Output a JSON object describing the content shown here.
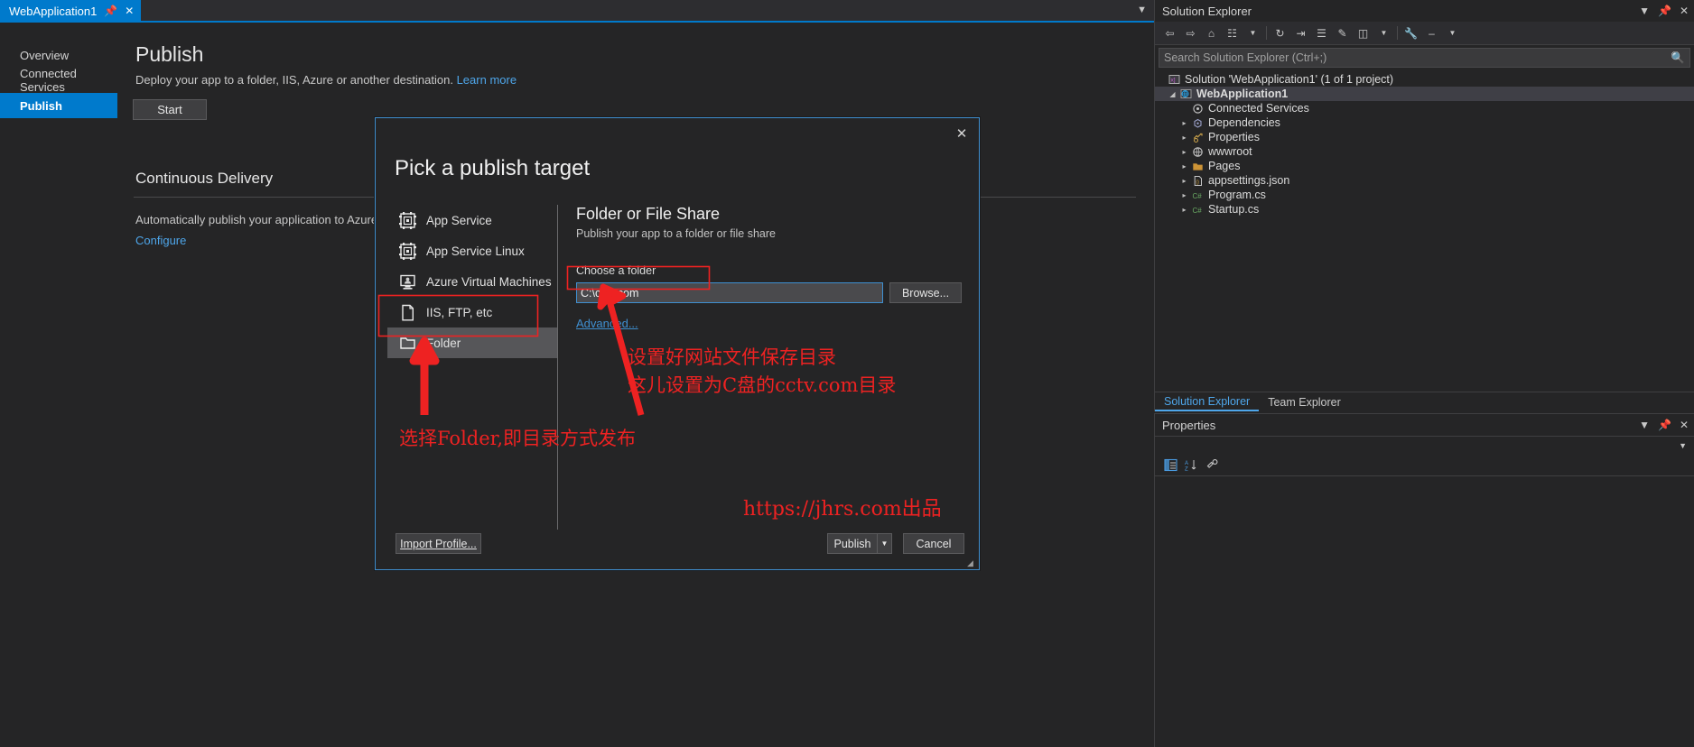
{
  "tabstrip": {
    "tab_label": "WebApplication1",
    "pin_icon": "pin-icon",
    "close_icon": "close-icon",
    "overflow_icon": "chevron-down-icon"
  },
  "doc_nav": {
    "items": [
      {
        "label": "Overview",
        "selected": false
      },
      {
        "label": "Connected Services",
        "selected": false
      },
      {
        "label": "Publish",
        "selected": true
      }
    ]
  },
  "publish_page": {
    "title": "Publish",
    "description": "Deploy your app to a folder, IIS, Azure or another destination.",
    "learn_more": "Learn more",
    "start_button": "Start",
    "cd_title": "Continuous Delivery",
    "cd_description": "Automatically publish your application to Azure with co",
    "configure_link": "Configure"
  },
  "dialog": {
    "heading": "Pick a publish target",
    "close_icon": "close-icon",
    "targets": [
      {
        "label": "App Service",
        "icon": "app-service-icon",
        "selected": false
      },
      {
        "label": "App Service Linux",
        "icon": "app-service-linux-icon",
        "selected": false
      },
      {
        "label": "Azure Virtual Machines",
        "icon": "azure-vm-icon",
        "selected": false
      },
      {
        "label": "IIS, FTP, etc",
        "icon": "iis-ftp-icon",
        "selected": false
      },
      {
        "label": "Folder",
        "icon": "folder-icon",
        "selected": true
      }
    ],
    "detail": {
      "title": "Folder or File Share",
      "subtitle": "Publish your app to a folder or file share",
      "choose_label": "Choose a folder",
      "folder_value": "C:\\cctv.com",
      "folder_placeholder": "",
      "browse_button": "Browse...",
      "advanced_link": "Advanced..."
    },
    "footer": {
      "import_profile": "Import Profile...",
      "publish_button": "Publish",
      "publish_dropdown_icon": "chevron-down-icon",
      "cancel_button": "Cancel",
      "resize_grip_icon": "resize-grip-icon"
    }
  },
  "annotations": {
    "color": "#ee2222",
    "folder_note": "选择Folder,即目录方式发布",
    "path_note_line1": "设置好网站文件保存目录",
    "path_note_line2": "这儿设置为C盘的cctv.com目录",
    "watermark": "https://jhrs.com出品"
  },
  "solution_explorer": {
    "title": "Solution Explorer",
    "header_icons": [
      "chevron-down-icon",
      "pin-icon",
      "close-icon"
    ],
    "toolbar_icons": [
      "back-icon",
      "forward-icon",
      "home-icon",
      "switch-views-icon",
      "chevron-down-icon",
      "refresh-icon",
      "collapse-all-icon",
      "show-all-files-icon",
      "properties-icon",
      "preview-icon",
      "chevron-down-icon",
      "wrench-icon",
      "minus-icon",
      "chevron-down-icon"
    ],
    "search_placeholder": "Search Solution Explorer (Ctrl+;)",
    "search_icon": "search-icon",
    "tree": [
      {
        "label": "Solution 'WebApplication1' (1 of 1 project)",
        "icon": "solution-icon",
        "depth": 0,
        "twisty": "",
        "bold": false,
        "highlight": false
      },
      {
        "label": "WebApplication1",
        "icon": "web-project-icon",
        "depth": 1,
        "twisty": "expanded",
        "bold": true,
        "highlight": true
      },
      {
        "label": "Connected Services",
        "icon": "connected-services-icon",
        "depth": 2,
        "twisty": "",
        "bold": false,
        "highlight": false
      },
      {
        "label": "Dependencies",
        "icon": "dependencies-icon",
        "depth": 2,
        "twisty": "collapsed",
        "bold": false,
        "highlight": false
      },
      {
        "label": "Properties",
        "icon": "properties-folder-icon",
        "depth": 2,
        "twisty": "collapsed",
        "bold": false,
        "highlight": false
      },
      {
        "label": "wwwroot",
        "icon": "wwwroot-icon",
        "depth": 2,
        "twisty": "collapsed",
        "bold": false,
        "highlight": false
      },
      {
        "label": "Pages",
        "icon": "folder-icon",
        "depth": 2,
        "twisty": "collapsed",
        "bold": false,
        "highlight": false
      },
      {
        "label": "appsettings.json",
        "icon": "json-icon",
        "depth": 2,
        "twisty": "collapsed",
        "bold": false,
        "highlight": false
      },
      {
        "label": "Program.cs",
        "icon": "csharp-icon",
        "depth": 2,
        "twisty": "collapsed",
        "bold": false,
        "highlight": false
      },
      {
        "label": "Startup.cs",
        "icon": "csharp-icon",
        "depth": 2,
        "twisty": "collapsed",
        "bold": false,
        "highlight": false
      }
    ],
    "tabs": [
      {
        "label": "Solution Explorer",
        "active": true
      },
      {
        "label": "Team Explorer",
        "active": false
      }
    ]
  },
  "properties_panel": {
    "title": "Properties",
    "header_icons": [
      "chevron-down-icon",
      "pin-icon",
      "close-icon"
    ],
    "toolbar_icons": [
      "categorized-icon",
      "alphabetical-icon",
      "property-pages-icon"
    ]
  }
}
